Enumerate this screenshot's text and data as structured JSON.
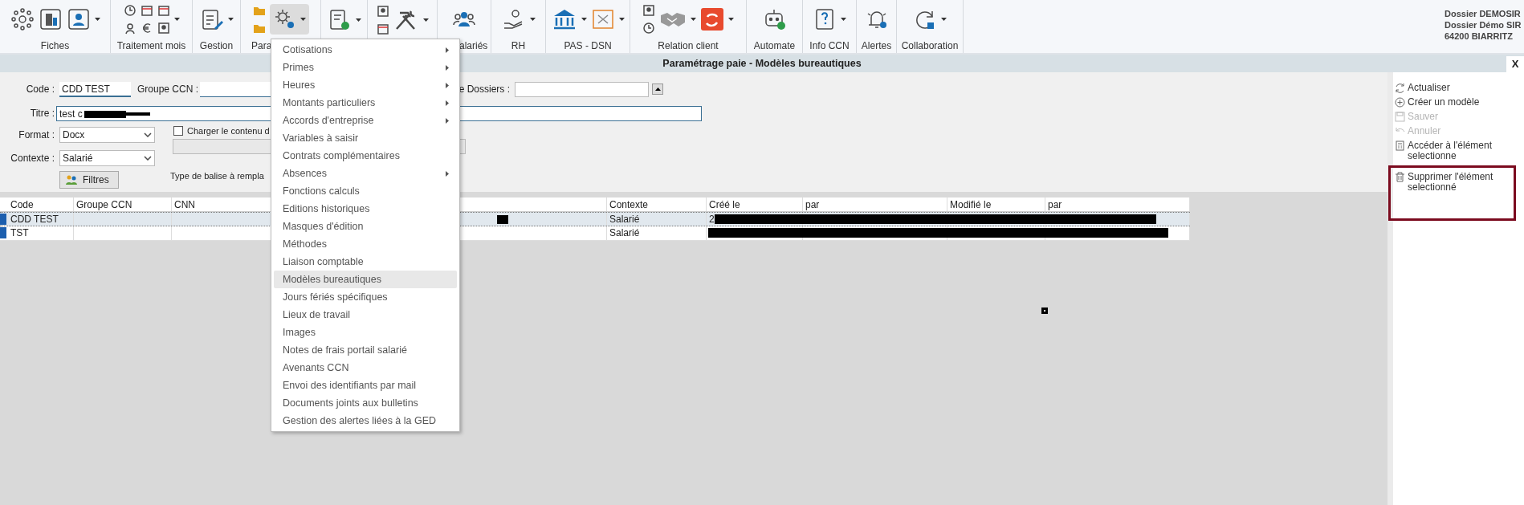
{
  "toolbar": {
    "groups": [
      {
        "label": "Fiches",
        "open": false
      },
      {
        "label": "Traitement mois",
        "open": false
      },
      {
        "label": "Gestion",
        "open": false
      },
      {
        "label": "Para",
        "open": true
      },
      {
        "open": false
      },
      {
        "open": false
      },
      {
        "label": "alariés",
        "open": false
      },
      {
        "label": "RH",
        "open": false
      },
      {
        "label": "PAS - DSN",
        "open": false
      },
      {
        "label": "Relation client",
        "open": false
      },
      {
        "label": "Automate",
        "open": false
      },
      {
        "label": "Info CCN",
        "open": false
      },
      {
        "label": "Alertes",
        "open": false
      },
      {
        "label": "Collaboration",
        "open": false
      }
    ],
    "dossier": [
      "Dossier DEMOSIR",
      "Dossier Démo SIR",
      "64200 BIARRITZ"
    ]
  },
  "window": {
    "title": "Paramétrage paie - Modèles bureautiques",
    "close": "X"
  },
  "form": {
    "code": {
      "label": "Code :",
      "value": "CDD TEST"
    },
    "groupe_ccn": {
      "label": "Groupe CCN :"
    },
    "dossiers": {
      "label": "e Dossiers :"
    },
    "titre": {
      "label": "Titre :",
      "value": "test c"
    },
    "format": {
      "label": "Format :",
      "value": "Docx"
    },
    "contexte": {
      "label": "Contexte :",
      "value": "Salarié"
    },
    "charger": {
      "label": "Charger le contenu d",
      "checked": false
    },
    "filtres": "Filtres",
    "type_balise": "Type de balise à rempla"
  },
  "table": {
    "columns": [
      {
        "label": "Code"
      },
      {
        "label": "Groupe CCN"
      },
      {
        "label": "CNN"
      },
      {},
      {
        "label": "Contexte"
      },
      {
        "label": "Créé le"
      },
      {
        "label": "par"
      },
      {
        "label": "Modifié le"
      },
      {
        "label": "par"
      }
    ],
    "rows": [
      {
        "selected": true,
        "code": "CDD TEST",
        "contexte": "Salarié",
        "cree_le": "2"
      },
      {
        "selected": false,
        "code": "TST",
        "contexte": "Salarié"
      }
    ]
  },
  "menu": {
    "items": [
      {
        "label": "Cotisations",
        "submenu": true,
        "selected": false
      },
      {
        "label": "Primes",
        "submenu": true,
        "selected": false
      },
      {
        "label": "Heures",
        "submenu": true,
        "selected": false
      },
      {
        "label": "Montants particuliers",
        "submenu": true,
        "selected": false
      },
      {
        "label": "Accords d'entreprise",
        "submenu": true,
        "selected": false
      },
      {
        "label": "Variables à saisir",
        "submenu": false,
        "selected": false
      },
      {
        "label": "Contrats complémentaires",
        "submenu": false,
        "selected": false
      },
      {
        "label": "Absences",
        "submenu": true,
        "selected": false
      },
      {
        "label": "Fonctions calculs",
        "submenu": false,
        "selected": false
      },
      {
        "label": "Editions historiques",
        "submenu": false,
        "selected": false
      },
      {
        "label": "Masques d'édition",
        "submenu": false,
        "selected": false
      },
      {
        "label": "Méthodes",
        "submenu": false,
        "selected": false
      },
      {
        "label": "Liaison comptable",
        "submenu": false,
        "selected": false
      },
      {
        "label": "Modèles bureautiques",
        "submenu": false,
        "selected": true
      },
      {
        "label": "Jours fériés spécifiques",
        "submenu": false,
        "selected": false
      },
      {
        "label": "Lieux de travail",
        "submenu": false,
        "selected": false
      },
      {
        "label": "Images",
        "submenu": false,
        "selected": false
      },
      {
        "label": "Notes de frais portail salarié",
        "submenu": false,
        "selected": false
      },
      {
        "label": "Avenants CCN",
        "submenu": false,
        "selected": false
      },
      {
        "label": "Envoi des identifiants par mail",
        "submenu": false,
        "selected": false
      },
      {
        "label": "Documents joints aux bulletins",
        "submenu": false,
        "selected": false
      },
      {
        "label": "Gestion des alertes liées à la GED",
        "submenu": false,
        "selected": false
      }
    ]
  },
  "actions": [
    {
      "label": "Actualiser",
      "disabled": false,
      "highlighted": false
    },
    {
      "label": "Créer un modèle",
      "disabled": false,
      "highlighted": false
    },
    {
      "label": "Sauver",
      "disabled": true,
      "highlighted": false
    },
    {
      "label": "Annuler",
      "disabled": true,
      "highlighted": false
    },
    {
      "label": "Accéder à l'élément selectionne",
      "disabled": false,
      "highlighted": false
    },
    {
      "label": "Supprimer l'élément selectionné",
      "disabled": false,
      "highlighted": true
    }
  ]
}
